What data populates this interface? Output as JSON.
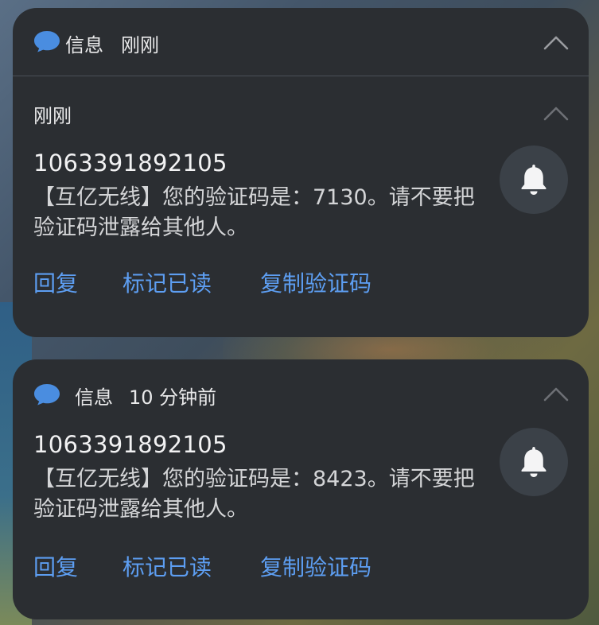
{
  "colors": {
    "card_bg": "#2b2e32",
    "accent_blue": "#5d9ef2",
    "text_primary": "#e9e9ea",
    "bell_bg": "#3b4148"
  },
  "notifications": [
    {
      "app_icon": "chat-bubble-icon",
      "app_name": "信息",
      "header_time": "刚刚",
      "group_time": "刚刚",
      "sender": "1063391892105",
      "body": "【互亿无线】您的验证码是：7130。请不要把验证码泄露给其他人。",
      "actions": [
        "回复",
        "标记已读",
        "复制验证码"
      ]
    },
    {
      "app_icon": "chat-bubble-icon",
      "app_name": "信息",
      "header_time": "10 分钟前",
      "sender": "1063391892105",
      "body": "【互亿无线】您的验证码是：8423。请不要把验证码泄露给其他人。",
      "actions": [
        "回复",
        "标记已读",
        "复制验证码"
      ]
    }
  ]
}
